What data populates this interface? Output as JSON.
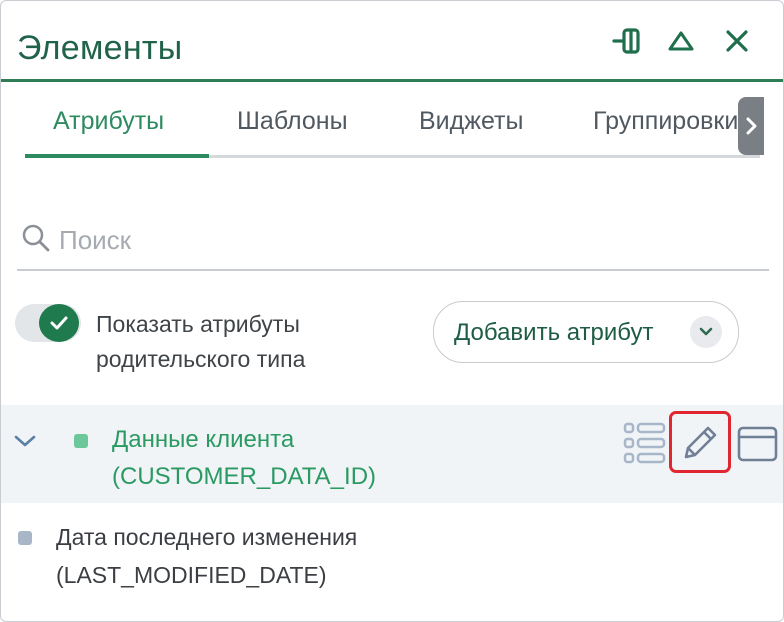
{
  "header": {
    "title": "Элементы"
  },
  "icons": {
    "dock": "dock-icon",
    "collapse": "collapse-icon",
    "close": "close-icon"
  },
  "tabs": [
    {
      "label": "Атрибуты",
      "active": true
    },
    {
      "label": "Шаблоны",
      "active": false
    },
    {
      "label": "Виджеты",
      "active": false
    },
    {
      "label": "Группировки",
      "active": false
    }
  ],
  "search": {
    "placeholder": "Поиск",
    "value": ""
  },
  "toggle": {
    "checked": true,
    "label_line1": "Показать атрибуты",
    "label_line2": "родительского типа"
  },
  "add_button": {
    "label": "Добавить атрибут"
  },
  "attributes": [
    {
      "name": "Данные клиента",
      "code": "(CUSTOMER_DATA_ID)",
      "expanded": true,
      "color": "#6cc79a"
    },
    {
      "name": "Дата последнего изменения",
      "code": "(LAST_MODIFIED_DATE)",
      "color": "#a9b6c8"
    }
  ],
  "colors": {
    "accent": "#2e8a5f",
    "highlight": "#e0262f"
  }
}
